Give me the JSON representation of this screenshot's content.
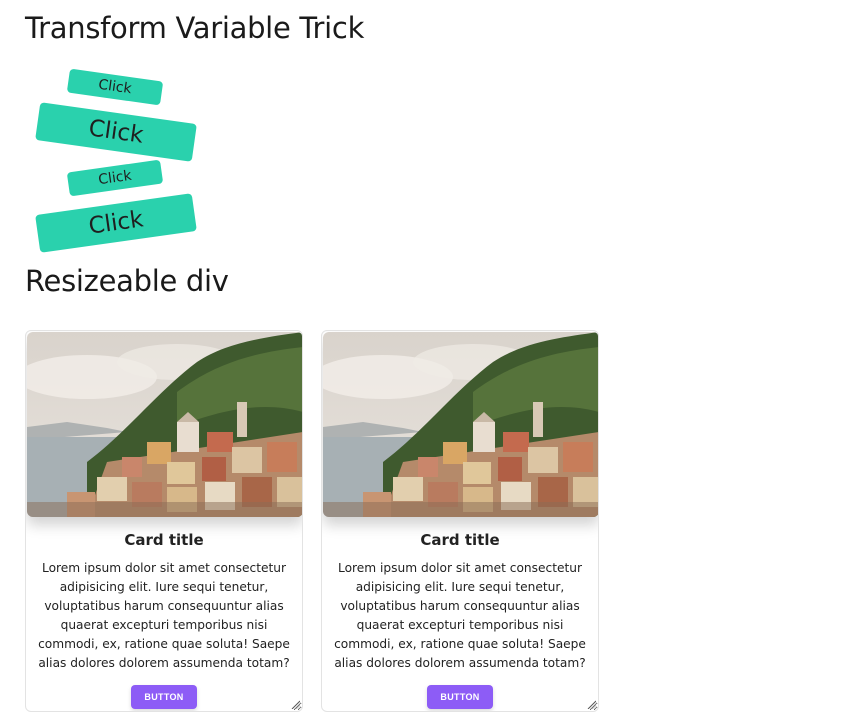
{
  "headings": {
    "transform": "Transform Variable Trick",
    "resize": "Resizeable div"
  },
  "transform_buttons": [
    {
      "label": "Click",
      "size": "small"
    },
    {
      "label": "Click",
      "size": "large"
    },
    {
      "label": "Click",
      "size": "small"
    },
    {
      "label": "Click",
      "size": "large"
    }
  ],
  "cards": [
    {
      "title": "Card title",
      "text": "Lorem ipsum dolor sit amet consectetur adipisicing elit. Iure sequi tenetur, voluptatibus harum consequuntur alias quaerat excepturi temporibus nisi commodi, ex, ratione quae soluta! Saepe alias dolores dolorem assumenda totam?",
      "button_label": "BUTTON",
      "image": "coastal-village-photo"
    },
    {
      "title": "Card title",
      "text": "Lorem ipsum dolor sit amet consectetur adipisicing elit. Iure sequi tenetur, voluptatibus harum consequuntur alias quaerat excepturi temporibus nisi commodi, ex, ratione quae soluta! Saepe alias dolores dolorem assumenda totam?",
      "button_label": "BUTTON",
      "image": "coastal-village-photo"
    }
  ],
  "colors": {
    "click_button": "#2ad1ad",
    "card_button": "#8d5cf6"
  },
  "icons": {
    "resize_grip": "resize-grip-icon"
  }
}
